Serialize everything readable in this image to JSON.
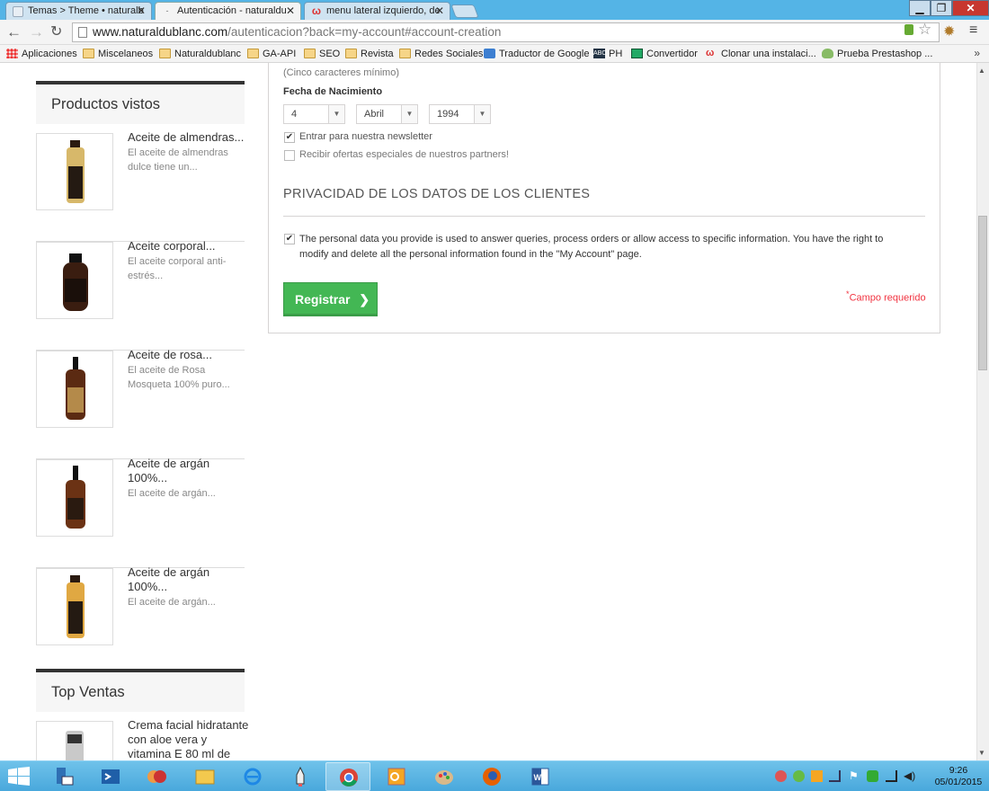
{
  "browser": {
    "tabs": [
      {
        "title": "Temas > Theme • naturalb",
        "active": false,
        "icon": "page-icon"
      },
      {
        "title": "Autenticación - naturaldu",
        "active": true,
        "icon": "page-icon"
      },
      {
        "title": "menu lateral izquierdo, de",
        "active": false,
        "icon": "w-icon"
      }
    ],
    "url_host": "www.naturaldublanc.com",
    "url_path": "/autenticacion?back=my-account#account-creation",
    "bookmarks": [
      "Aplicaciones",
      "Miscelaneos",
      "Naturaldublanc",
      "GA-API",
      "SEO",
      "Revista",
      "Redes Sociales",
      "Traductor de Google",
      "PH",
      "Convertidor",
      "Clonar una instalaci...",
      "Prueba Prestashop ..."
    ],
    "more_bookmarks": "»"
  },
  "sidebar": {
    "viewed_title": "Productos vistos",
    "viewed": [
      {
        "name": "Aceite de almendras...",
        "desc": "El aceite de almendras dulce tiene un..."
      },
      {
        "name": "Aceite corporal...",
        "desc": "El aceite corporal anti-estrés..."
      },
      {
        "name": "Aceite de rosa...",
        "desc": "El aceite de Rosa Mosqueta 100% puro..."
      },
      {
        "name": "Aceite de argán 100%...",
        "desc": "El aceite de argán..."
      },
      {
        "name": "Aceite de argán 100%...",
        "desc": "El aceite de argán..."
      }
    ],
    "top_title": "Top Ventas",
    "top": [
      {
        "name": "Crema facial hidratante con aloe vera y vitamina E 80 ml de"
      }
    ]
  },
  "form": {
    "min_chars": "(Cinco caracteres mínimo)",
    "birth_label": "Fecha de Nacimiento",
    "day": "4",
    "month": "Abril",
    "year": "1994",
    "newsletter_label": "Entrar para nuestra newsletter",
    "newsletter_checked": true,
    "partners_label": "Recibir ofertas especiales de nuestros partners!",
    "partners_checked": false,
    "privacy_title": "PRIVACIDAD DE LOS DATOS DE LOS CLIENTES",
    "privacy_text": "The personal data you provide is used to answer queries, process orders or allow access to specific information. You have the right to modify and delete all the personal information found in the \"My Account\" page.",
    "privacy_checked": true,
    "submit_label": "Registrar",
    "submit_arrow": "❯",
    "required_mark": "*",
    "required_label": "Campo requerido"
  },
  "taskbar": {
    "time": "9:26",
    "date": "05/01/2015"
  },
  "colors": {
    "accent_green": "#43b754",
    "required_red": "#f13340",
    "taskbar_blue": "#49a8dc"
  }
}
